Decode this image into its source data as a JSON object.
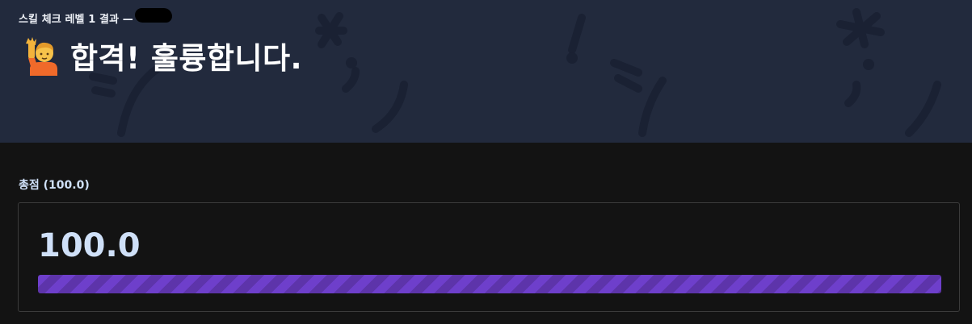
{
  "header": {
    "subtitle": "스킬 체크 레벨 1 결과 —",
    "title": "합격! 훌륭합니다.",
    "title_icon": "person-raising-hand-icon",
    "background_color": "#222a3d"
  },
  "score": {
    "label": "총점 (100.0)",
    "value": "100.0",
    "progress_percent": 100,
    "bar_color": "#6439b6"
  }
}
